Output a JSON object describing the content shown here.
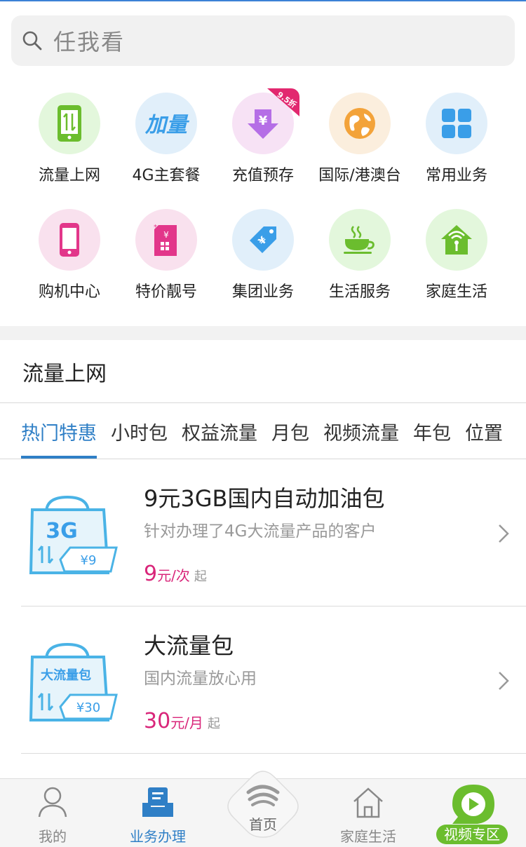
{
  "search": {
    "placeholder": "任我看",
    "icon": "search-icon"
  },
  "grid_items": [
    {
      "label": "流量上网",
      "icon": "phone-data-icon",
      "bg": "#e3f7dc"
    },
    {
      "label": "4G主套餐",
      "icon": "jialiang-text-icon",
      "bg": "#e1effa"
    },
    {
      "label": "充值预存",
      "icon": "yuan-download-icon",
      "bg": "#f7e2f5",
      "badge": "9.5折"
    },
    {
      "label": "国际/港澳台",
      "icon": "globe-icon",
      "bg": "#fbeedd"
    },
    {
      "label": "常用业务",
      "icon": "four-squares-icon",
      "bg": "#e1effa"
    },
    {
      "label": "购机中心",
      "icon": "mobile-phone-icon",
      "bg": "#f9e1ee"
    },
    {
      "label": "特价靓号",
      "icon": "sim-card-icon",
      "bg": "#f9e1ee"
    },
    {
      "label": "集团业务",
      "icon": "price-tag-icon",
      "bg": "#e1effa"
    },
    {
      "label": "生活服务",
      "icon": "coffee-cup-icon",
      "bg": "#e3f7dc"
    },
    {
      "label": "家庭生活",
      "icon": "home-wifi-icon",
      "bg": "#e3f7dc"
    }
  ],
  "section": {
    "title": "流量上网"
  },
  "tabs": [
    "热门特惠",
    "小时包",
    "权益流量",
    "月包",
    "视频流量",
    "年包",
    "位置"
  ],
  "products": [
    {
      "title": "9元3GB国内自动加油包",
      "desc": "针对办理了4G大流量产品的客户",
      "price": "9",
      "unit": "元/次",
      "from": "起",
      "thumb_top": "3G",
      "thumb_price": "¥9"
    },
    {
      "title": "大流量包",
      "desc": "国内流量放心用",
      "price": "30",
      "unit": "元/月",
      "from": "起",
      "thumb_top": "大流量包",
      "thumb_price": "¥30"
    }
  ],
  "nav": {
    "me": "我的",
    "business": "业务办理",
    "home": "首页",
    "family": "家庭生活",
    "video": "视频专区"
  },
  "colors": {
    "accent": "#2f7fc6",
    "price": "#d9267a",
    "green": "#6bbd2e"
  }
}
